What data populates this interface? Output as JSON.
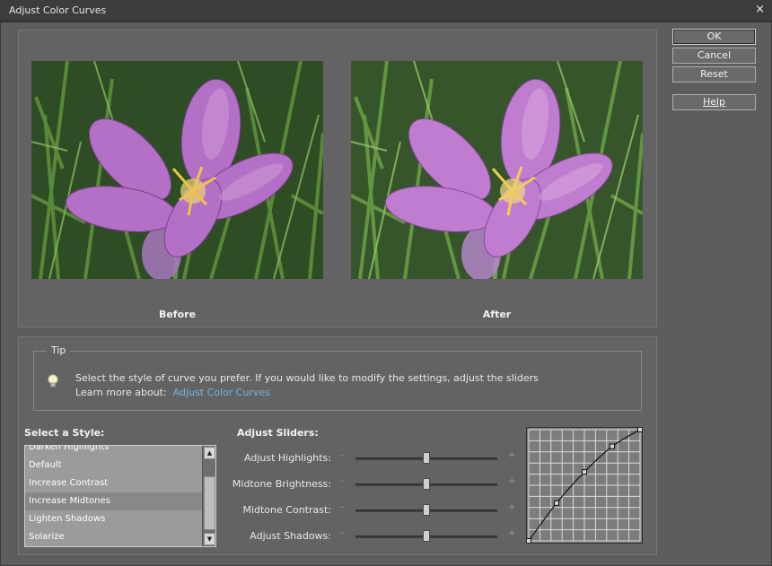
{
  "window": {
    "title": "Adjust Color Curves",
    "close_glyph": "×"
  },
  "buttons": {
    "ok": "OK",
    "cancel": "Cancel",
    "reset": "Reset",
    "help": "Help"
  },
  "preview": {
    "before_label": "Before",
    "after_label": "After"
  },
  "tip": {
    "legend": "Tip",
    "line1": "Select the style of curve you prefer. If you would like to modify the settings, adjust the sliders",
    "line2_prefix": "Learn more about:",
    "link": "Adjust Color Curves"
  },
  "styles": {
    "label": "Select a Style:",
    "items": [
      "Darken Highlights",
      "Default",
      "Increase Contrast",
      "Increase Midtones",
      "Lighten Shadows",
      "Solarize"
    ],
    "selected": "Increase Midtones"
  },
  "sliders": {
    "label": "Adjust Sliders:",
    "minus": "–",
    "plus": "+",
    "items": [
      {
        "name": "Adjust Highlights:",
        "value": 0.5
      },
      {
        "name": "Midtone Brightness:",
        "value": 0.5
      },
      {
        "name": "Midtone Contrast:",
        "value": 0.5
      },
      {
        "name": "Adjust Shadows:",
        "value": 0.5
      }
    ]
  },
  "curve": {
    "grid_divisions": 10,
    "points": [
      [
        0,
        0
      ],
      [
        0.25,
        0.34
      ],
      [
        0.5,
        0.62
      ],
      [
        0.75,
        0.85
      ],
      [
        1,
        1
      ]
    ]
  },
  "colors": {
    "background": "#5d5d5d",
    "panel": "#636363",
    "link": "#6fb4ea",
    "petal": "#b76fc4",
    "grass": "#3c6a2a"
  }
}
